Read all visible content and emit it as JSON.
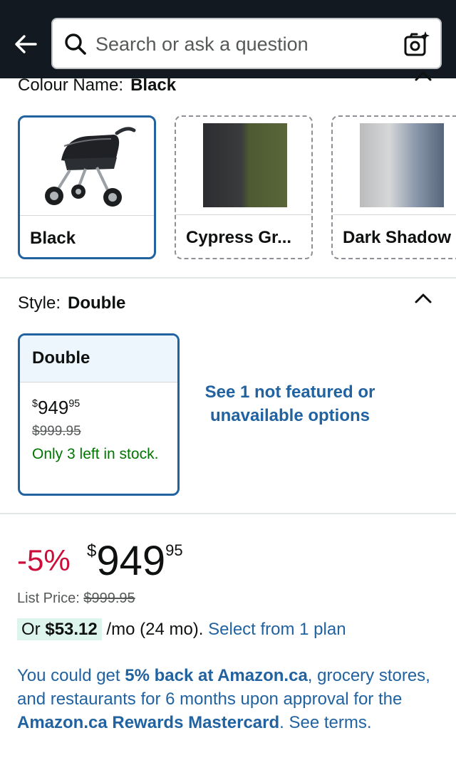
{
  "search": {
    "placeholder": "Search or ask a question"
  },
  "colour": {
    "label": "Colour Name:",
    "selected": "Black",
    "swatches": [
      {
        "name": "Black",
        "selected": true
      },
      {
        "name": "Cypress Gr...",
        "selected": false
      },
      {
        "name": "Dark Shadow",
        "selected": false
      }
    ]
  },
  "style": {
    "label": "Style:",
    "selected": "Double",
    "card": {
      "title": "Double",
      "currency": "$",
      "price_whole": "949",
      "price_fraction": "95",
      "list_price": "$999.95",
      "stock": "Only 3 left in stock."
    },
    "more_options": "See 1 not featured or unavailable options"
  },
  "pricing": {
    "discount": "-5%",
    "currency": "$",
    "price_whole": "949",
    "price_fraction": "95",
    "list_price_label": "List Price:",
    "list_price": "$999.95",
    "monthly_prefix": "Or",
    "monthly_amount": "$53.12",
    "monthly_term": "/mo (24 mo).",
    "plan_link": "Select from 1 plan"
  },
  "promo": {
    "part1": "You could get ",
    "bold1": "5% back at Amazon.ca",
    "part2": ", grocery stores, and restaurants for 6 months upon approval for the ",
    "bold2": "Amazon.ca Rewards Mastercard",
    "part3": ". See terms."
  },
  "colors": {
    "header_bg": "#131921",
    "accent_blue": "#2162a1",
    "discount_red": "#cc0c39",
    "stock_green": "#007600"
  },
  "icons": [
    "back-arrow-icon",
    "search-icon",
    "camera-search-icon",
    "chevron-up-icon"
  ]
}
